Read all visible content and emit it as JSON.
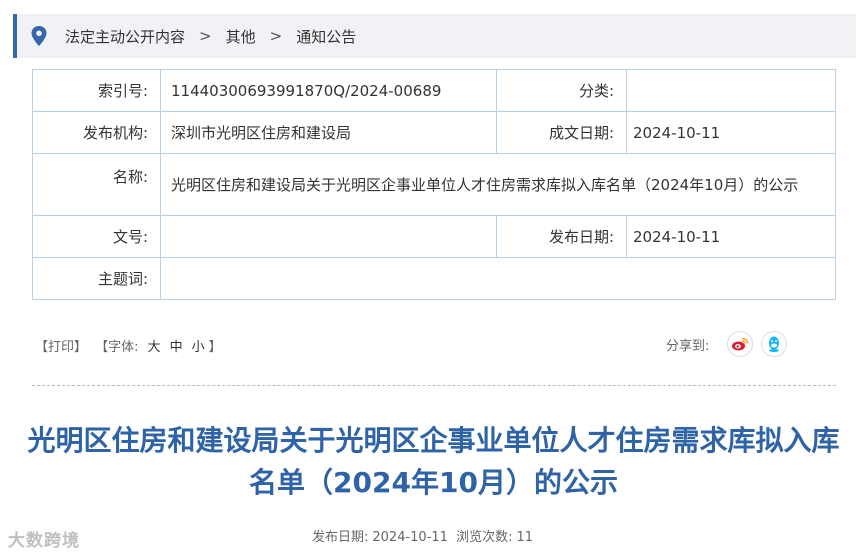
{
  "breadcrumb": {
    "items": [
      "法定主动公开内容",
      "其他",
      "通知公告"
    ],
    "separator": ">"
  },
  "info": {
    "index_label": "索引号:",
    "index_value": "11440300693991870Q/2024-00689",
    "category_label": "分类:",
    "category_value": "",
    "org_label": "发布机构:",
    "org_value": "深圳市光明区住房和建设局",
    "created_label": "成文日期:",
    "created_value": "2024-10-11",
    "name_label": "名称:",
    "name_value": "光明区住房和建设局关于光明区企事业单位人才住房需求库拟入库名单（2024年10月）的公示",
    "docno_label": "文号:",
    "docno_value": "",
    "published_label": "发布日期:",
    "published_value": "2024-10-11",
    "subject_label": "主题词:",
    "subject_value": ""
  },
  "tools": {
    "print": "【打印】",
    "font_prefix": "【字体:",
    "font_large": "大",
    "font_medium": "中",
    "font_small": "小",
    "font_suffix": "】",
    "share_label": "分享到:"
  },
  "article": {
    "title": "光明区住房和建设局关于光明区企事业单位人才住房需求库拟入库名单（2024年10月）的公示",
    "meta_date_label": "发布日期:",
    "meta_date": "2024-10-11",
    "meta_views_label": "浏览次数:",
    "meta_views": "11"
  },
  "watermark": "大数跨境",
  "colors": {
    "accent": "#3466a8",
    "title": "#2f63a7",
    "table_border": "#b9d0e4",
    "weibo": "#e6162d",
    "qq": "#12b7f5"
  },
  "icons": {
    "location": "location-pin-icon",
    "weibo": "weibo-icon",
    "qq": "qq-icon"
  }
}
